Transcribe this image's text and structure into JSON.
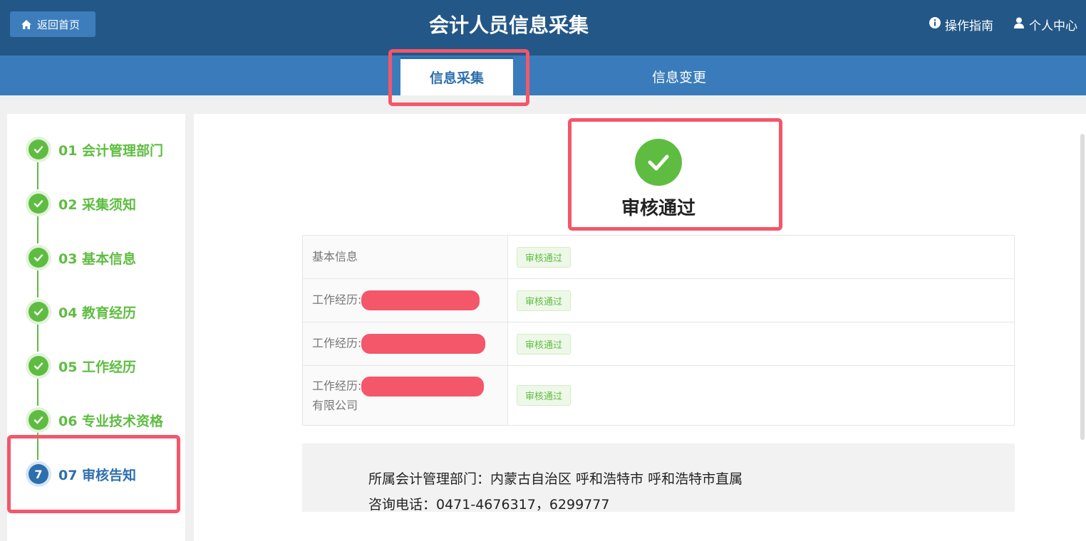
{
  "header": {
    "home_label": "返回首页",
    "title": "会计人员信息采集",
    "guide_label": "操作指南",
    "user_center_label": "个人中心"
  },
  "tabs": [
    {
      "label": "信息采集",
      "active": true
    },
    {
      "label": "信息变更",
      "active": false
    }
  ],
  "steps": [
    {
      "label": "01 会计管理部门",
      "status": "done"
    },
    {
      "label": "02 采集须知",
      "status": "done"
    },
    {
      "label": "03 基本信息",
      "status": "done"
    },
    {
      "label": "04 教育经历",
      "status": "done"
    },
    {
      "label": "05 工作经历",
      "status": "done"
    },
    {
      "label": "06 专业技术资格",
      "status": "done"
    },
    {
      "label": "07 审核告知",
      "status": "current",
      "number": "7"
    }
  ],
  "result": {
    "title": "审核通过"
  },
  "review_table": [
    {
      "label": "基本信息",
      "suffix": "",
      "status": "审核通过"
    },
    {
      "label": "工作经历:",
      "suffix": "",
      "status": "审核通过"
    },
    {
      "label": "工作经历:",
      "suffix": "",
      "status": "审核通过"
    },
    {
      "label": "工作经历:",
      "suffix": "有限公司",
      "status": "审核通过"
    }
  ],
  "dept_info": {
    "dept_line": "所属会计管理部门：内蒙古自治区 呼和浩特市 呼和浩特市直属",
    "phone_line": "咨询电话：0471-4676317，6299777"
  },
  "colors": {
    "header_bg": "#235787",
    "tabbar_bg": "#3a7cbb",
    "success": "#5ebd41",
    "current": "#2d6fae",
    "highlight": "#f4566a"
  }
}
